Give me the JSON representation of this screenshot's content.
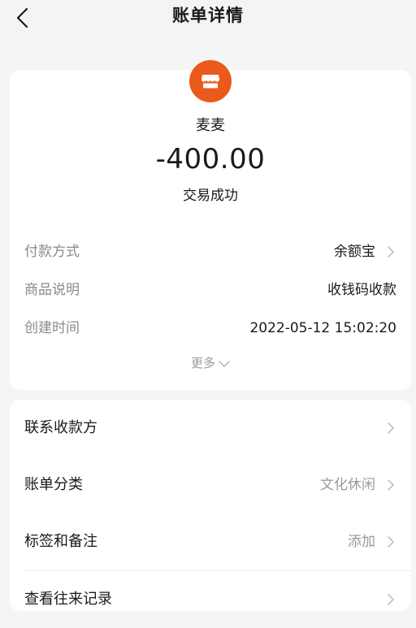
{
  "header": {
    "title": "账单详情"
  },
  "bill": {
    "merchant_name": "麦麦",
    "amount": "-400.00",
    "status": "交易成功",
    "details": [
      {
        "label": "付款方式",
        "value": "余额宝"
      },
      {
        "label": "商品说明",
        "value": "收钱码收款"
      },
      {
        "label": "创建时间",
        "value": "2022-05-12 15:02:20"
      }
    ],
    "more_label": "更多"
  },
  "actions": [
    {
      "label": "联系收款方",
      "value": ""
    },
    {
      "label": "账单分类",
      "value": "文化休闲"
    },
    {
      "label": "标签和备注",
      "value": "添加"
    },
    {
      "label": "查看往来记录",
      "value": ""
    }
  ],
  "colors": {
    "brand_orange": "#e95a1b",
    "label_gray": "#8a8a8a",
    "muted_gray": "#9a9a9a",
    "background": "#f5f5f5"
  },
  "icons": {
    "back": "chevron-left-icon",
    "merchant": "shop-icon",
    "row_chevron": "chevron-right-icon",
    "more": "chevron-down-icon"
  }
}
